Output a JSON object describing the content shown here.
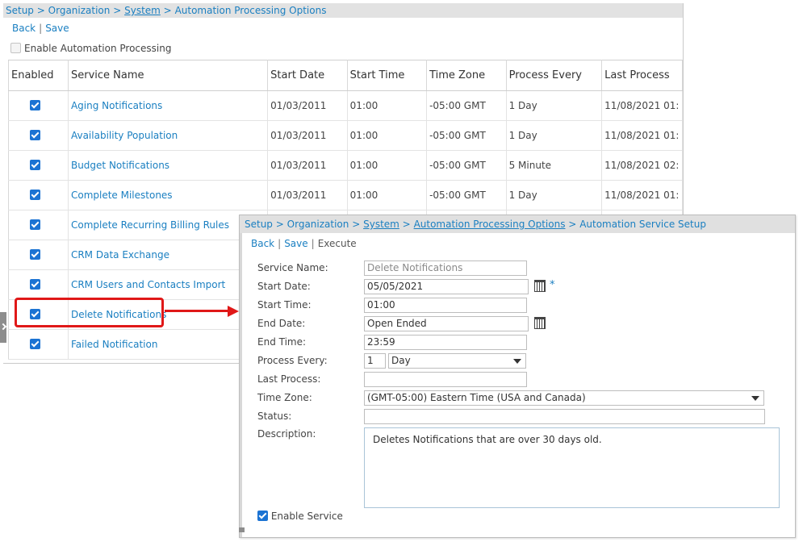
{
  "main": {
    "breadcrumb": [
      "Setup",
      "Organization",
      "System",
      "Automation Processing Options"
    ],
    "breadcrumb_sep": ">",
    "actions": {
      "back": "Back",
      "save": "Save",
      "sep": "|"
    },
    "enable_automation_label": "Enable Automation Processing",
    "table": {
      "columns": [
        "Enabled",
        "Service Name",
        "Start Date",
        "Start Time",
        "Time Zone",
        "Process Every",
        "Last Process"
      ],
      "rows": [
        {
          "name": "Aging Notifications",
          "start_date": "01/03/2011",
          "start_time": "01:00",
          "tz": "-05:00 GMT",
          "every": "1 Day",
          "last": "11/08/2021 01:"
        },
        {
          "name": "Availability Population",
          "start_date": "01/03/2011",
          "start_time": "01:00",
          "tz": "-05:00 GMT",
          "every": "1 Day",
          "last": "11/08/2021 01:"
        },
        {
          "name": "Budget Notifications",
          "start_date": "01/03/2011",
          "start_time": "01:00",
          "tz": "-05:00 GMT",
          "every": "5 Minute",
          "last": "11/08/2021 02:"
        },
        {
          "name": "Complete Milestones",
          "start_date": "01/03/2011",
          "start_time": "01:00",
          "tz": "-05:00 GMT",
          "every": "1 Day",
          "last": "11/08/2021 01:"
        },
        {
          "name": "Complete Recurring Billing Rules",
          "start_date": "",
          "start_time": "",
          "tz": "",
          "every": "",
          "last": ""
        },
        {
          "name": "CRM Data Exchange",
          "start_date": "",
          "start_time": "",
          "tz": "",
          "every": "",
          "last": ""
        },
        {
          "name": "CRM Users and Contacts Import",
          "start_date": "",
          "start_time": "",
          "tz": "",
          "every": "",
          "last": ""
        },
        {
          "name": "Delete Notifications",
          "start_date": "",
          "start_time": "",
          "tz": "",
          "every": "",
          "last": ""
        },
        {
          "name": "Failed Notification",
          "start_date": "",
          "start_time": "",
          "tz": "",
          "every": "",
          "last": ""
        }
      ]
    }
  },
  "setup": {
    "breadcrumb": [
      "Setup",
      "Organization",
      "System",
      "Automation Processing Options",
      "Automation Service Setup"
    ],
    "breadcrumb_sep": ">",
    "actions": {
      "back": "Back",
      "save": "Save",
      "execute": "Execute",
      "sep": "|"
    },
    "fields": {
      "service_name": {
        "label": "Service Name:",
        "value": "Delete Notifications"
      },
      "start_date": {
        "label": "Start Date:",
        "value": "05/05/2021"
      },
      "start_time": {
        "label": "Start Time:",
        "value": "01:00"
      },
      "end_date": {
        "label": "End Date:",
        "value": "Open Ended"
      },
      "end_time": {
        "label": "End Time:",
        "value": "23:59"
      },
      "process_every": {
        "label": "Process Every:",
        "count": "1",
        "unit": "Day"
      },
      "last_process": {
        "label": "Last Process:",
        "value": ""
      },
      "time_zone": {
        "label": "Time Zone:",
        "value": "(GMT-05:00) Eastern Time (USA and Canada)"
      },
      "status": {
        "label": "Status:",
        "value": ""
      },
      "description": {
        "label": "Description:",
        "value": "Deletes Notifications that are over 30 days old."
      }
    },
    "required_mark": "*",
    "enable_service_label": "Enable Service"
  },
  "colors": {
    "link": "#1a7fc1",
    "highlight": "#e01818",
    "checkbox": "#1b73d3"
  }
}
